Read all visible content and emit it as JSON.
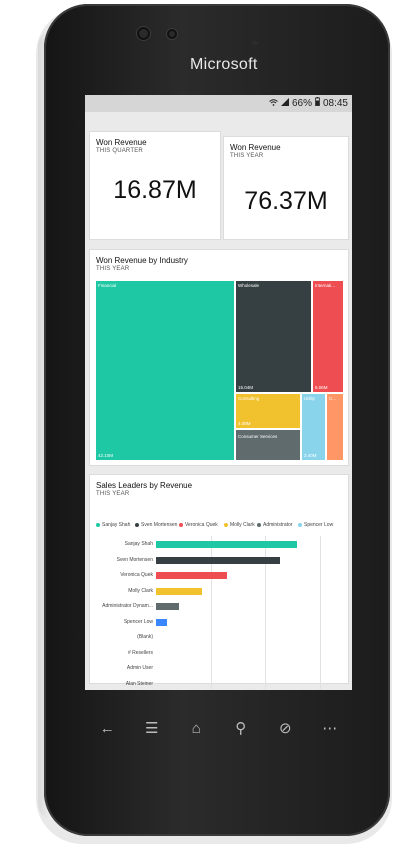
{
  "device": {
    "brand": "Microsoft"
  },
  "statusbar": {
    "battery": "66%",
    "time": "08:45",
    "icons": [
      "wifi-icon",
      "signal-icon",
      "battery-icon"
    ]
  },
  "kpis": [
    {
      "title": "Won Revenue",
      "subtitle": "THIS QUARTER",
      "value": "16.87M"
    },
    {
      "title": "Won Revenue",
      "subtitle": "THIS YEAR",
      "value": "76.37M"
    }
  ],
  "treemap": {
    "title": "Won Revenue by Industry",
    "subtitle": "THIS YEAR",
    "cells": [
      {
        "label": "Financial",
        "value": "42.10M",
        "color": "#1ec8a5"
      },
      {
        "label": "Wholesale",
        "value": "15.04M",
        "color": "#364043"
      },
      {
        "label": "Internati...",
        "value": "6.06M",
        "color": "#ee4e52"
      },
      {
        "label": "Consulting",
        "value": "4.08M",
        "color": "#f2c12e"
      },
      {
        "label": "Utility",
        "value": "2.40M",
        "color": "#8ad4eb"
      },
      {
        "label": "C...",
        "value": "",
        "color": "#fe9666"
      },
      {
        "label": "Consumer Services",
        "value": "",
        "color": "#5f6b6d"
      }
    ]
  },
  "sales": {
    "title": "Sales Leaders by Revenue",
    "subtitle": "THIS YEAR",
    "legend": [
      {
        "name": "Sanjay Shah",
        "color": "#1ec8a5"
      },
      {
        "name": "Sven Mortensen",
        "color": "#364043"
      },
      {
        "name": "Veronica Quek",
        "color": "#ee4e52"
      },
      {
        "name": "Molly Clark",
        "color": "#f2c12e"
      },
      {
        "name": "Administrator",
        "color": "#5f6b6d"
      },
      {
        "name": "Spencer Low",
        "color": "#8ad4eb"
      }
    ],
    "chart_data": {
      "type": "bar",
      "orientation": "horizontal",
      "categories": [
        "Sanjay Shah",
        "Sven Mortensen",
        "Veronica Quek",
        "Molly Clark",
        "Administrator Dynam...",
        "Spencer Low",
        "(Blank)",
        "# Resellers",
        "Admin User",
        "Alan Steiner"
      ],
      "values": [
        25.8,
        22.6,
        13.0,
        8.5,
        4.2,
        2.1,
        0,
        0,
        0,
        0
      ],
      "colors": [
        "#1ec8a5",
        "#364043",
        "#ee4e52",
        "#f2c12e",
        "#5f6b6d",
        "#3a86ff",
        "#1ec8a5",
        "#1ec8a5",
        "#1ec8a5",
        "#1ec8a5"
      ],
      "ticks": [
        "0M",
        "10M",
        "20M",
        "30M"
      ],
      "xlim": [
        0,
        30
      ],
      "grid": true,
      "legend_position": "top"
    }
  },
  "nav": [
    "back-icon",
    "menu-icon",
    "home-icon",
    "search-icon",
    "browser-icon",
    "more-icon"
  ]
}
